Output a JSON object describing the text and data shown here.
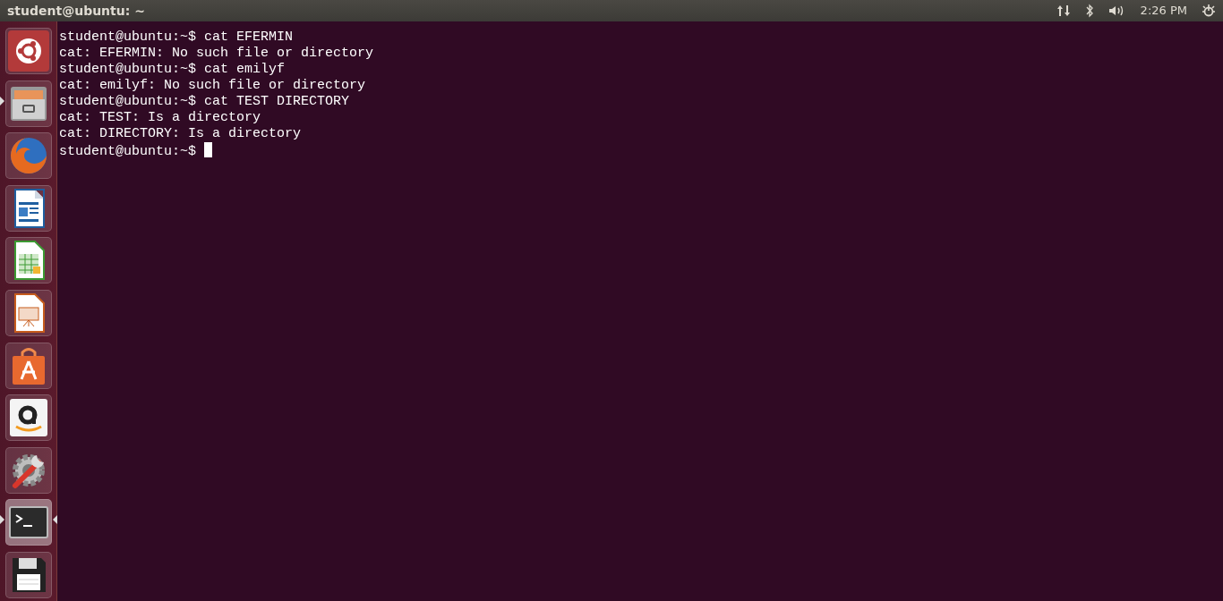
{
  "top_bar": {
    "title": "student@ubuntu: ~",
    "clock": "2:26 PM"
  },
  "launcher": [
    {
      "kind": "dash",
      "running": false,
      "focused": false
    },
    {
      "kind": "files",
      "running": true,
      "focused": false
    },
    {
      "kind": "browser",
      "running": false,
      "focused": false
    },
    {
      "kind": "writer",
      "running": false,
      "focused": false
    },
    {
      "kind": "calc",
      "running": false,
      "focused": false
    },
    {
      "kind": "impress",
      "running": false,
      "focused": false
    },
    {
      "kind": "software",
      "running": false,
      "focused": false
    },
    {
      "kind": "amazon",
      "running": false,
      "focused": false
    },
    {
      "kind": "settings",
      "running": false,
      "focused": false
    },
    {
      "kind": "terminal",
      "running": true,
      "focused": true
    },
    {
      "kind": "floppy",
      "running": false,
      "focused": false
    }
  ],
  "terminal": {
    "lines": [
      "student@ubuntu:~$ cat EFERMIN",
      "cat: EFERMIN: No such file or directory",
      "student@ubuntu:~$ cat emilyf",
      "cat: emilyf: No such file or directory",
      "student@ubuntu:~$ cat TEST DIRECTORY",
      "cat: TEST: Is a directory",
      "cat: DIRECTORY: Is a directory",
      "student@ubuntu:~$ "
    ],
    "cursor_visible": true
  }
}
